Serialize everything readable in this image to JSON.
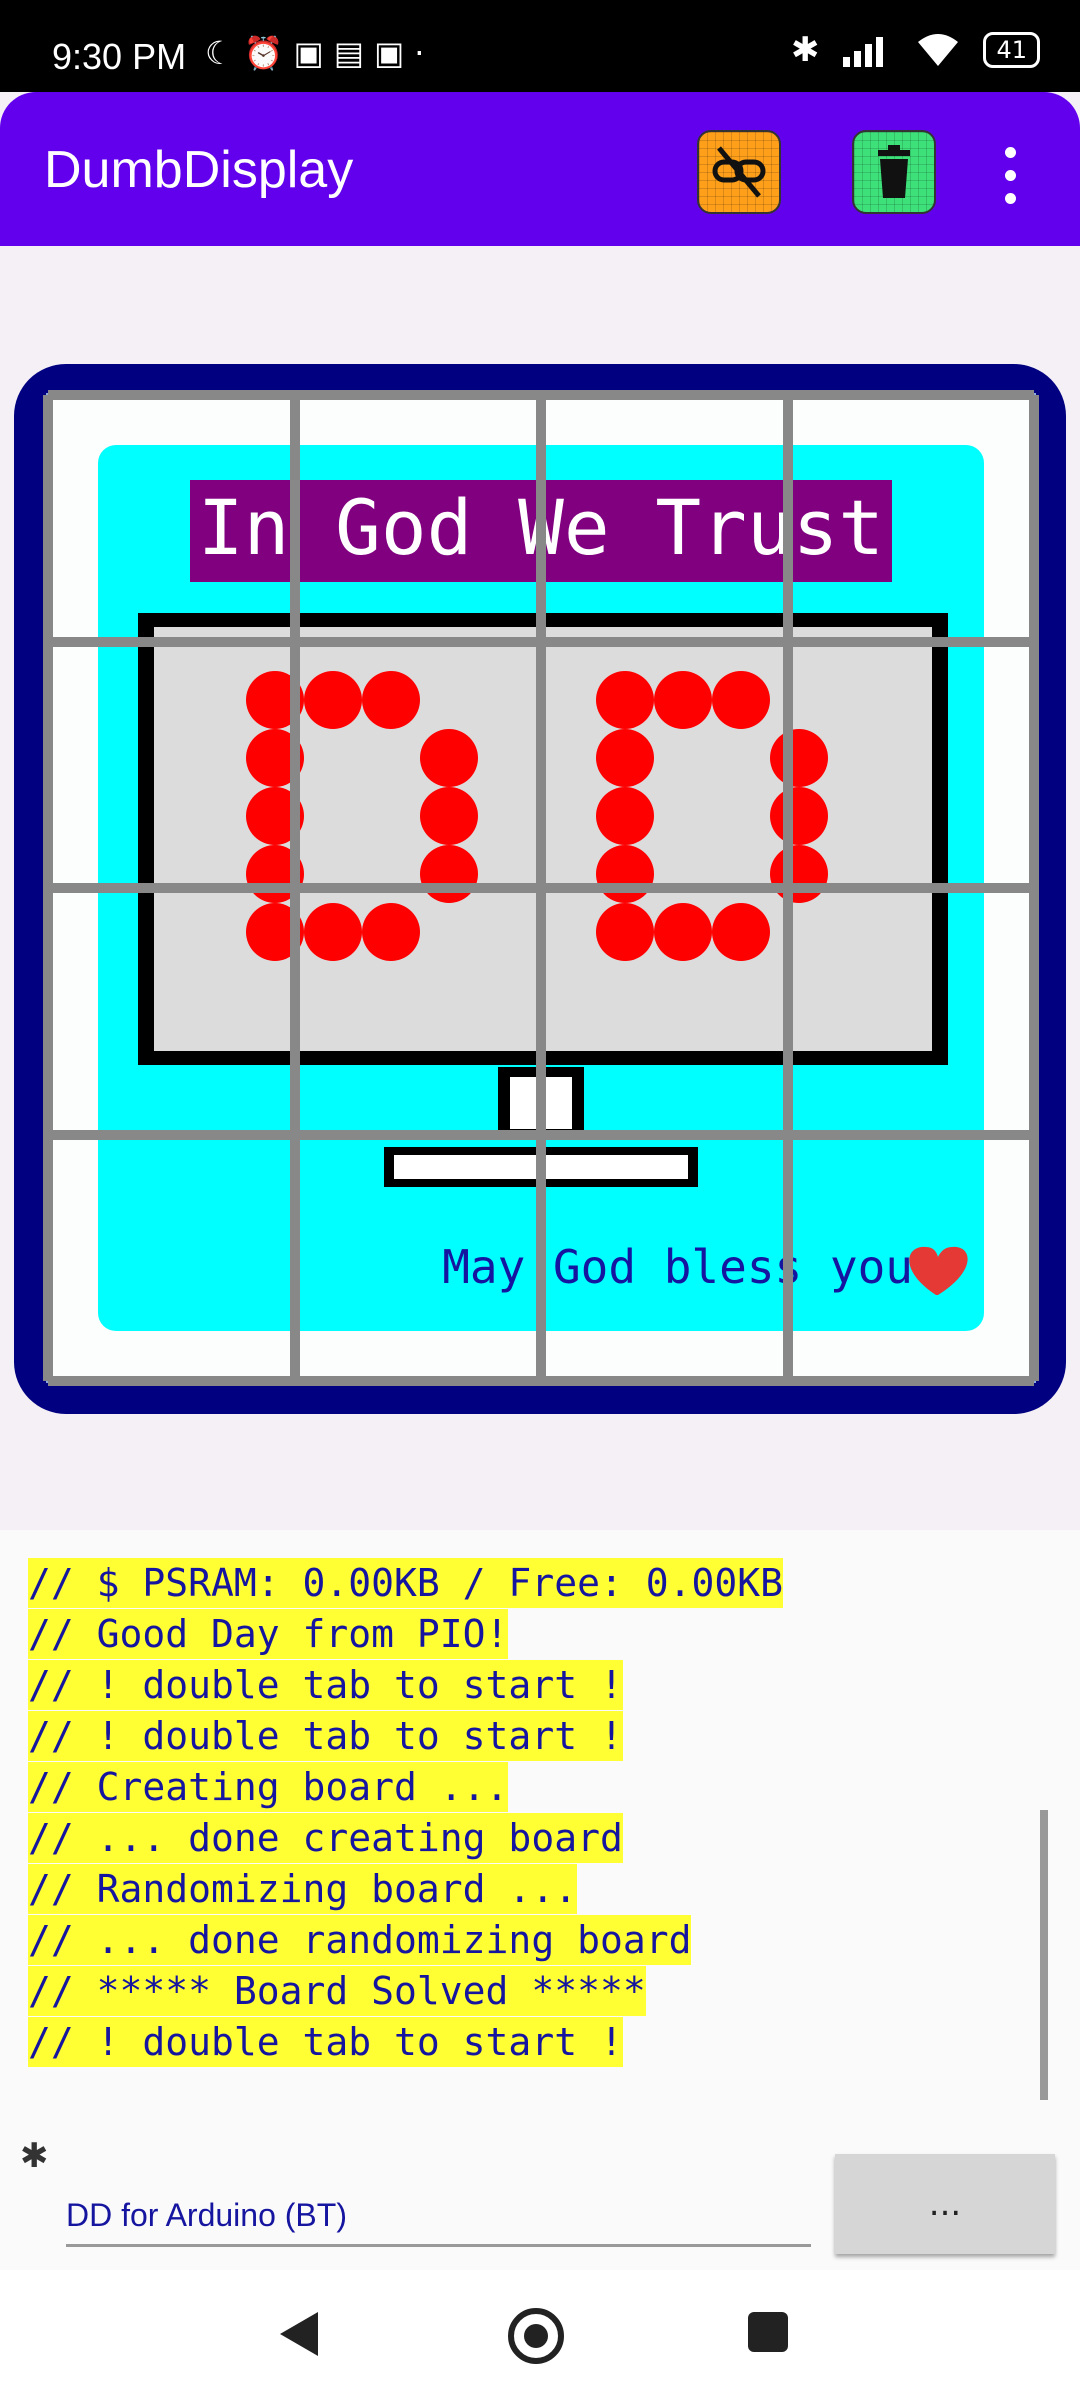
{
  "status_bar": {
    "time": "9:30 PM",
    "left_icons": [
      "moon-icon",
      "alarm-icon",
      "notification-icon",
      "news-icon",
      "notification-icon",
      "dot-icon"
    ],
    "right_icons": [
      "bluetooth-icon",
      "signal-icon",
      "wifi-icon"
    ],
    "battery": "41"
  },
  "app_bar": {
    "title": "DumbDisplay",
    "actions": [
      {
        "name": "disconnect-button",
        "icon": "link-off-icon",
        "color": "#ff9f1a"
      },
      {
        "name": "clear-button",
        "icon": "trash-icon",
        "color": "#3ee07a"
      }
    ],
    "overflow_icon": "more-vert-icon"
  },
  "colors": {
    "primary": "#6200ee",
    "frame": "#000080",
    "panel": "#00ffff",
    "banner": "#800080",
    "led": "#ff0000",
    "log_text": "#1515a0",
    "log_highlight": "#ffff33"
  },
  "puzzle": {
    "grid": "4x4",
    "banner_text": "In God We Trust",
    "footer_text": "May God bless you",
    "footer_icon": "heart-icon",
    "led_characters": [
      "D",
      "D"
    ]
  },
  "log": {
    "lines": [
      "// $ PSRAM: 0.00KB / Free: 0.00KB",
      "// Good Day from PIO!",
      "// ! double tab to start !",
      "// ! double tab to start !",
      "// Creating board ...",
      "// ... done creating board",
      "// Randomizing board ...",
      "// ... done randomizing board",
      "// ***** Board Solved *****",
      "// ! double tab to start !"
    ]
  },
  "bottom": {
    "connection_icon": "bluetooth-icon",
    "device_name": "DD for Arduino (BT)",
    "more_button": "..."
  },
  "nav_bar": {
    "buttons": [
      "back-icon",
      "home-icon",
      "recents-icon"
    ]
  }
}
